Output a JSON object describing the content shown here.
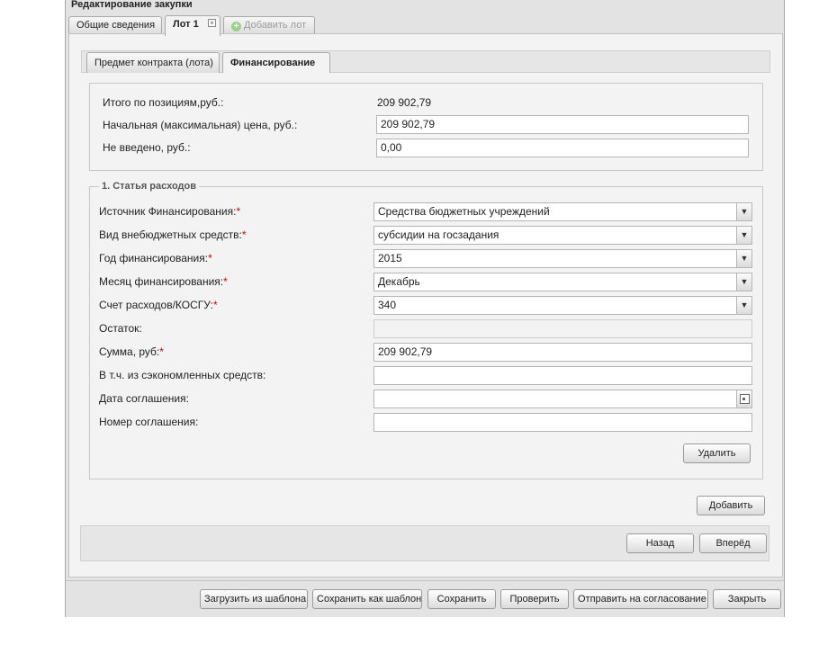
{
  "window": {
    "title": "Редактирование закупки"
  },
  "tabs": {
    "general": "Общие сведения",
    "lot1": "Лот 1",
    "close_glyph": "×",
    "add_lot": "Добавить лот"
  },
  "inner_tabs": {
    "subject": "Предмет контракта (лота)",
    "financing": "Финансирование"
  },
  "summary": {
    "total_label": "Итого по позициям,руб.:",
    "total_value": "209 902,79",
    "initial_price_label": "Начальная (максимальная) цена, руб.:",
    "initial_price_value": "209 902,79",
    "not_entered_label": "Не введено, руб.:",
    "not_entered_value": "0,00"
  },
  "expense": {
    "legend": "1. Статья расходов",
    "required_mark": "*",
    "source_label": "Источник Финансирования:",
    "source_value": "Средства бюджетных учреждений",
    "extra_funds_label": "Вид внебюджетных средств:",
    "extra_funds_value": "субсидии на госзадания",
    "year_label": "Год финансирования:",
    "year_value": "2015",
    "month_label": "Месяц финансирования:",
    "month_value": "Декабрь",
    "account_label": "Счет расходов/КОСГУ:",
    "account_value": "340",
    "remainder_label": "Остаток:",
    "remainder_value": "",
    "sum_label": "Сумма, руб:",
    "sum_value": "209 902,79",
    "saved_label": "В т.ч. из сэкономленных средств:",
    "saved_value": "",
    "agreement_date_label": "Дата соглашения:",
    "agreement_date_value": "",
    "agreement_number_label": "Номер соглашения:",
    "agreement_number_value": "",
    "delete_button": "Удалить"
  },
  "add_button": "Добавить",
  "nav": {
    "back": "Назад",
    "forward": "Вперёд"
  },
  "footer": {
    "load_template": "Загрузить из шаблона",
    "save_template": "Сохранить как шаблон",
    "save": "Сохранить",
    "check": "Проверить",
    "send": "Отправить на согласование",
    "close": "Закрыть"
  },
  "icons": {
    "combo_arrow": "chevron-down-icon",
    "calendar": "calendar-icon",
    "add": "plus-icon",
    "close": "close-icon"
  }
}
